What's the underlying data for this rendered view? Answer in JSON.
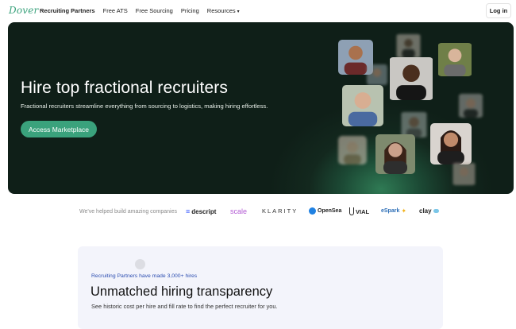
{
  "nav": {
    "logo": "Dover",
    "links": [
      {
        "label": "Recruiting Partners",
        "active": true
      },
      {
        "label": "Free ATS"
      },
      {
        "label": "Free Sourcing"
      },
      {
        "label": "Pricing"
      },
      {
        "label": "Resources"
      }
    ],
    "login_label": "Log in"
  },
  "hero": {
    "title": "Hire top fractional recruiters",
    "subtitle": "Fractional recruiters streamline everything from sourcing to logistics, making hiring effortless.",
    "cta_label": "Access Marketplace",
    "accent_color": "#3aa27c",
    "background_color": "#0f1f18"
  },
  "logos": {
    "label": "We've helped build amazing companies",
    "brands": [
      "descript",
      "scale",
      "KLARITY",
      "OpenSea",
      "VIAL",
      "eSpark",
      "clay"
    ]
  },
  "card": {
    "tag": "Recruiting Partners have made 3,000+ hires",
    "title": "Unmatched hiring transparency",
    "subtitle": "See historic cost per hire and fill rate to find the perfect recruiter for you."
  }
}
